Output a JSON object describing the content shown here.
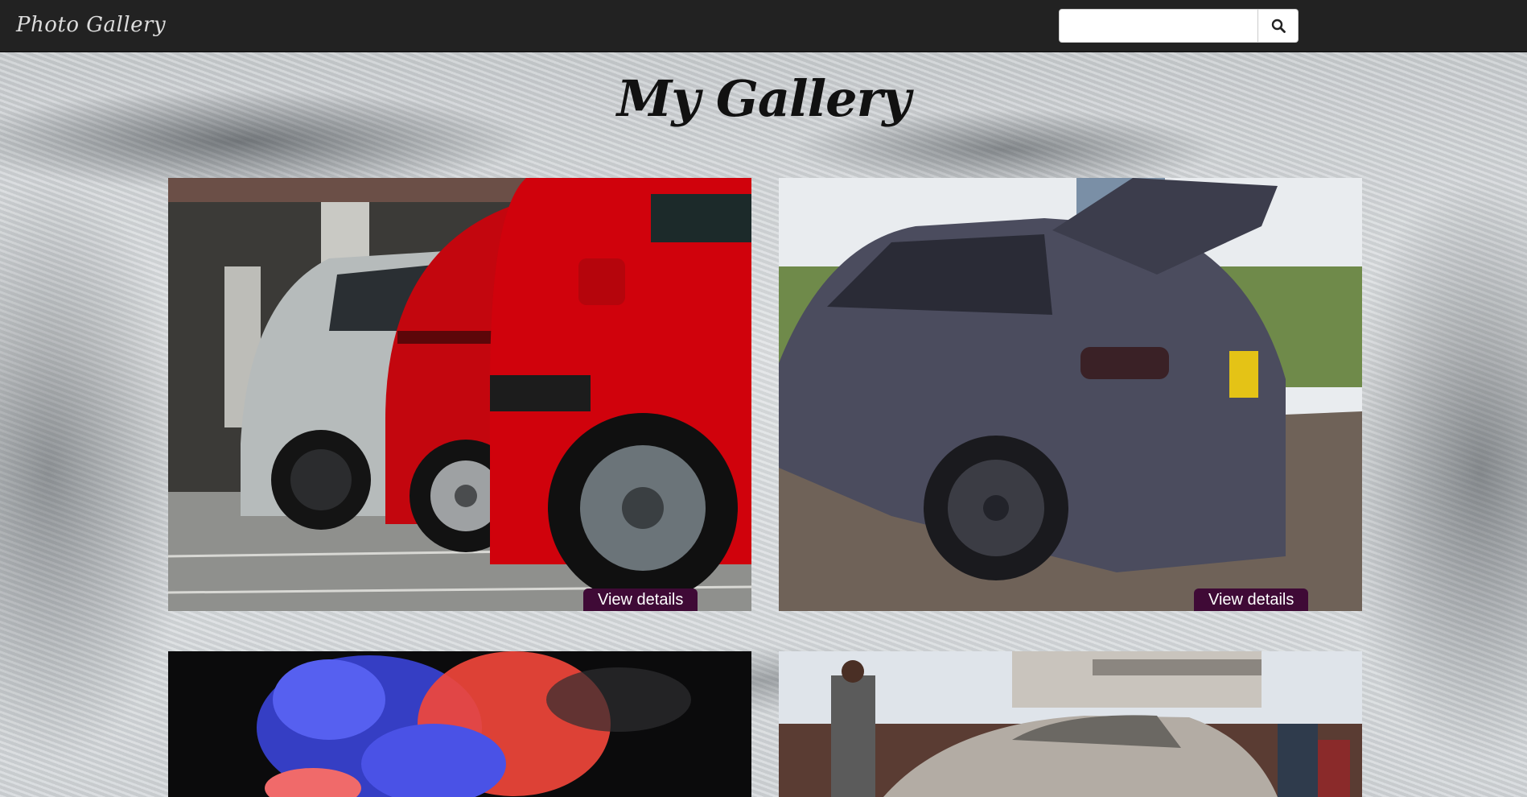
{
  "navbar": {
    "brand": "Photo Gallery",
    "search": {
      "value": "",
      "placeholder": ""
    },
    "search_icon": "search-icon"
  },
  "page": {
    "title": "My Gallery"
  },
  "gallery": {
    "cards": [
      {
        "image": "row of red, red and silver hatchback cars parked",
        "button": "View details"
      },
      {
        "image": "dark grey hatchback with large rear wing",
        "button": "View details"
      },
      {
        "image": "blue and red colored smoke on black background"
      },
      {
        "image": "silver sports car at a crowded car meet"
      }
    ]
  },
  "colors": {
    "navbar_bg": "#222222",
    "details_button_bg": "#3f0a36",
    "details_button_text": "#ffffff"
  }
}
